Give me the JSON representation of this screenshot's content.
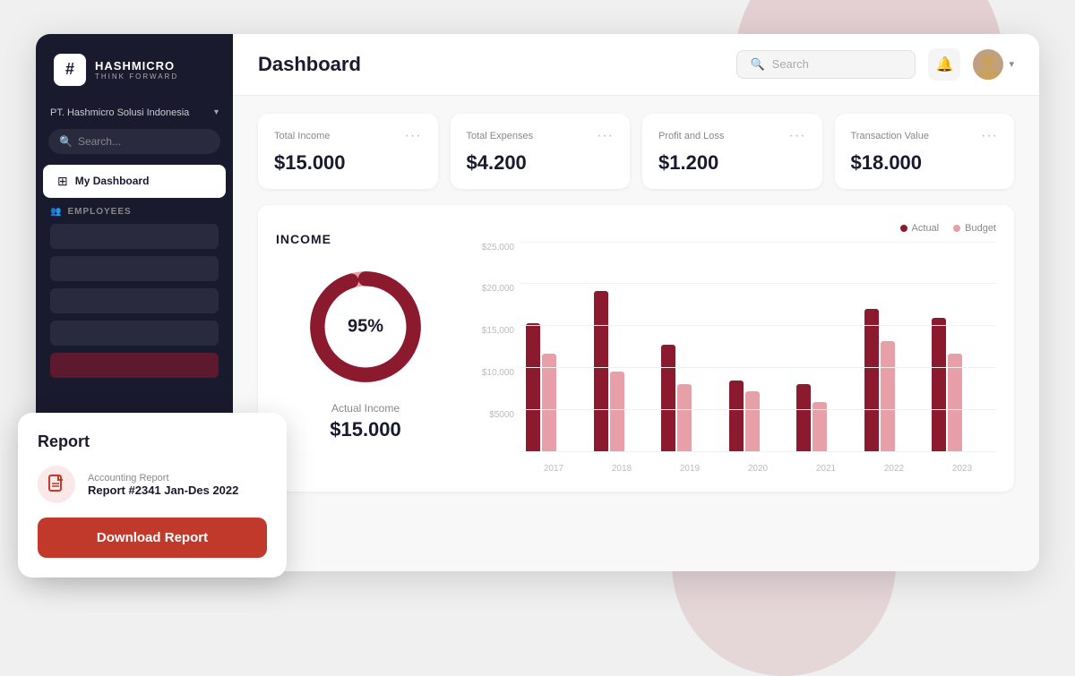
{
  "app": {
    "logo": {
      "icon": "#",
      "brand": "HASHMICRO",
      "tagline": "THINK FORWARD"
    },
    "company": "PT. Hashmicro Solusi Indonesia"
  },
  "sidebar": {
    "search_placeholder": "Search...",
    "nav": [
      {
        "id": "dashboard",
        "icon": "⊞",
        "label": "My Dashboard",
        "active": true
      }
    ],
    "section_employees": "EMPLOYEES",
    "skeletons": 5
  },
  "header": {
    "title": "Dashboard",
    "search_placeholder": "Search",
    "bell_icon": "🔔",
    "avatar_initial": "👤"
  },
  "stats": [
    {
      "label": "Total Income",
      "value": "$15.000"
    },
    {
      "label": "Total Expenses",
      "value": "$4.200"
    },
    {
      "label": "Profit and Loss",
      "value": "$1.200"
    },
    {
      "label": "Transaction Value",
      "value": "$18.000"
    }
  ],
  "income_chart": {
    "title": "INCOME",
    "donut": {
      "percent": "95%",
      "label": "Actual Income",
      "value": "$15.000",
      "actual_ratio": 0.95,
      "color_actual": "#8b1a2e",
      "color_budget": "#e8a0a8"
    },
    "legend": {
      "actual": "Actual",
      "budget": "Budget"
    },
    "y_labels": [
      "$25,000",
      "$20,000",
      "$15,000",
      "$10,000",
      "$5000",
      ""
    ],
    "bars": [
      {
        "year": "2017",
        "actual": 72,
        "budget": 55
      },
      {
        "year": "2018",
        "actual": 90,
        "budget": 45
      },
      {
        "year": "2019",
        "actual": 60,
        "budget": 38
      },
      {
        "year": "2020",
        "actual": 40,
        "budget": 34
      },
      {
        "year": "2021",
        "actual": 38,
        "budget": 28
      },
      {
        "year": "2022",
        "actual": 80,
        "budget": 62
      },
      {
        "year": "2023",
        "actual": 75,
        "budget": 55
      }
    ]
  },
  "report_popup": {
    "title": "Report",
    "report_type": "Accounting Report",
    "report_name": "Report #2341 Jan-Des 2022",
    "download_label": "Download Report",
    "icon": "📄"
  }
}
